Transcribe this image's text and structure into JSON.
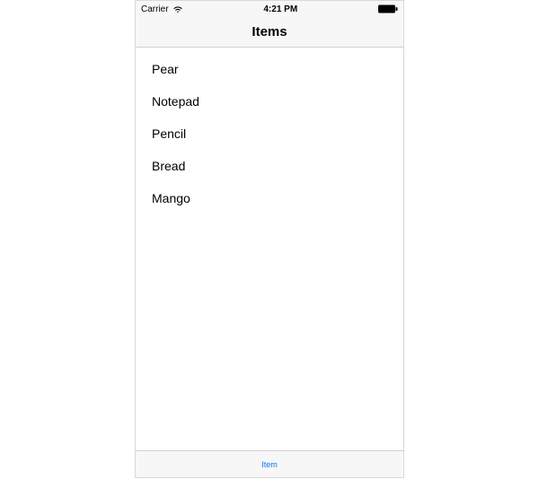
{
  "status_bar": {
    "carrier": "Carrier",
    "time": "4:21 PM"
  },
  "nav": {
    "title": "Items"
  },
  "list": {
    "items": [
      {
        "label": "Pear"
      },
      {
        "label": "Notepad"
      },
      {
        "label": "Pencil"
      },
      {
        "label": "Bread"
      },
      {
        "label": "Mango"
      }
    ]
  },
  "tab_bar": {
    "items": [
      {
        "label": "Item"
      }
    ]
  }
}
